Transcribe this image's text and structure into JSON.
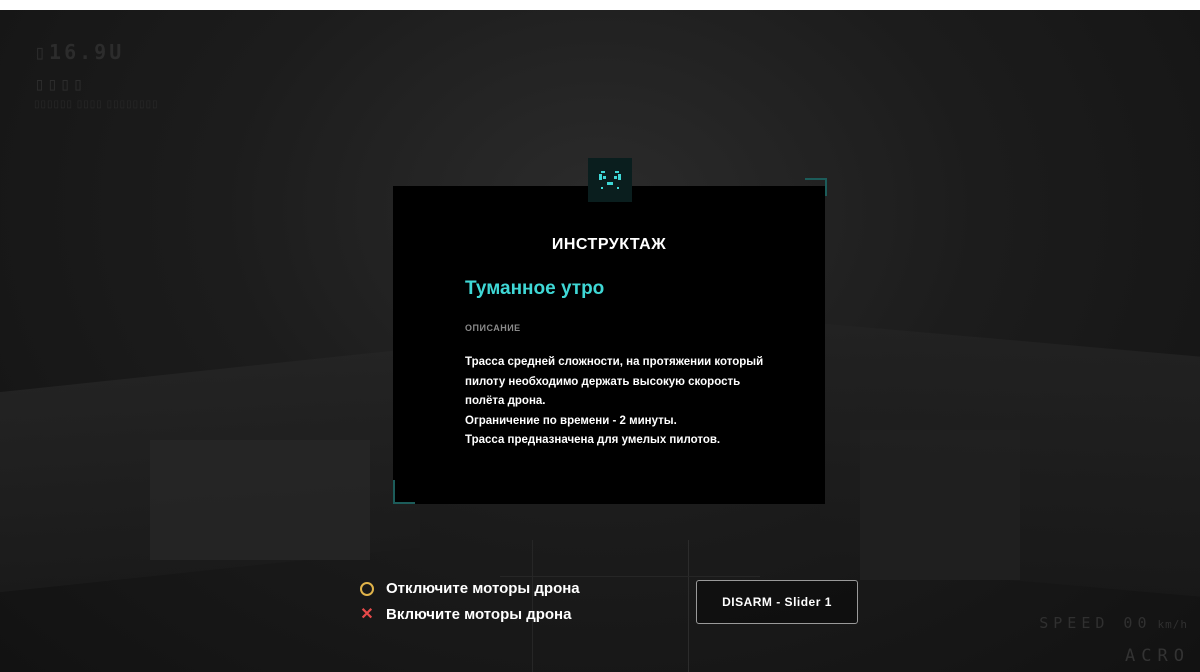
{
  "hud": {
    "top_left": {
      "line1": "▯16.9U",
      "line2": "▯▯▯▯",
      "line3": "▯▯▯▯▯▯ ▯▯▯▯ ▯▯▯▯▯▯▯▯"
    },
    "speed_label": "SPEED 00",
    "speed_unit": "km/h",
    "flight_mode": "ACRO"
  },
  "briefing": {
    "icon": "drone-face-icon",
    "title": "ИНСТРУКТАЖ",
    "track_name": "Туманное утро",
    "description_label": "ОПИСАНИЕ",
    "description_lines": [
      "Трасса средней сложности, на протяжении который",
      "пилоту необходимо держать высокую скорость",
      "полёта дрона.",
      "Ограничение по времени - 2 минуты.",
      "Трасса предназначена для умелых пилотов."
    ]
  },
  "controls": {
    "hints": [
      {
        "icon": "circle-icon",
        "text": "Отключите моторы дрона"
      },
      {
        "icon": "cross-icon",
        "text": "Включите моторы дрона"
      }
    ],
    "disarm_button_label": "DISARM - Slider 1"
  },
  "colors": {
    "accent": "#3fd8d6",
    "circle_hint": "#e0b34a",
    "cross_hint": "#e84a4a",
    "panel_bg": "#000000"
  }
}
